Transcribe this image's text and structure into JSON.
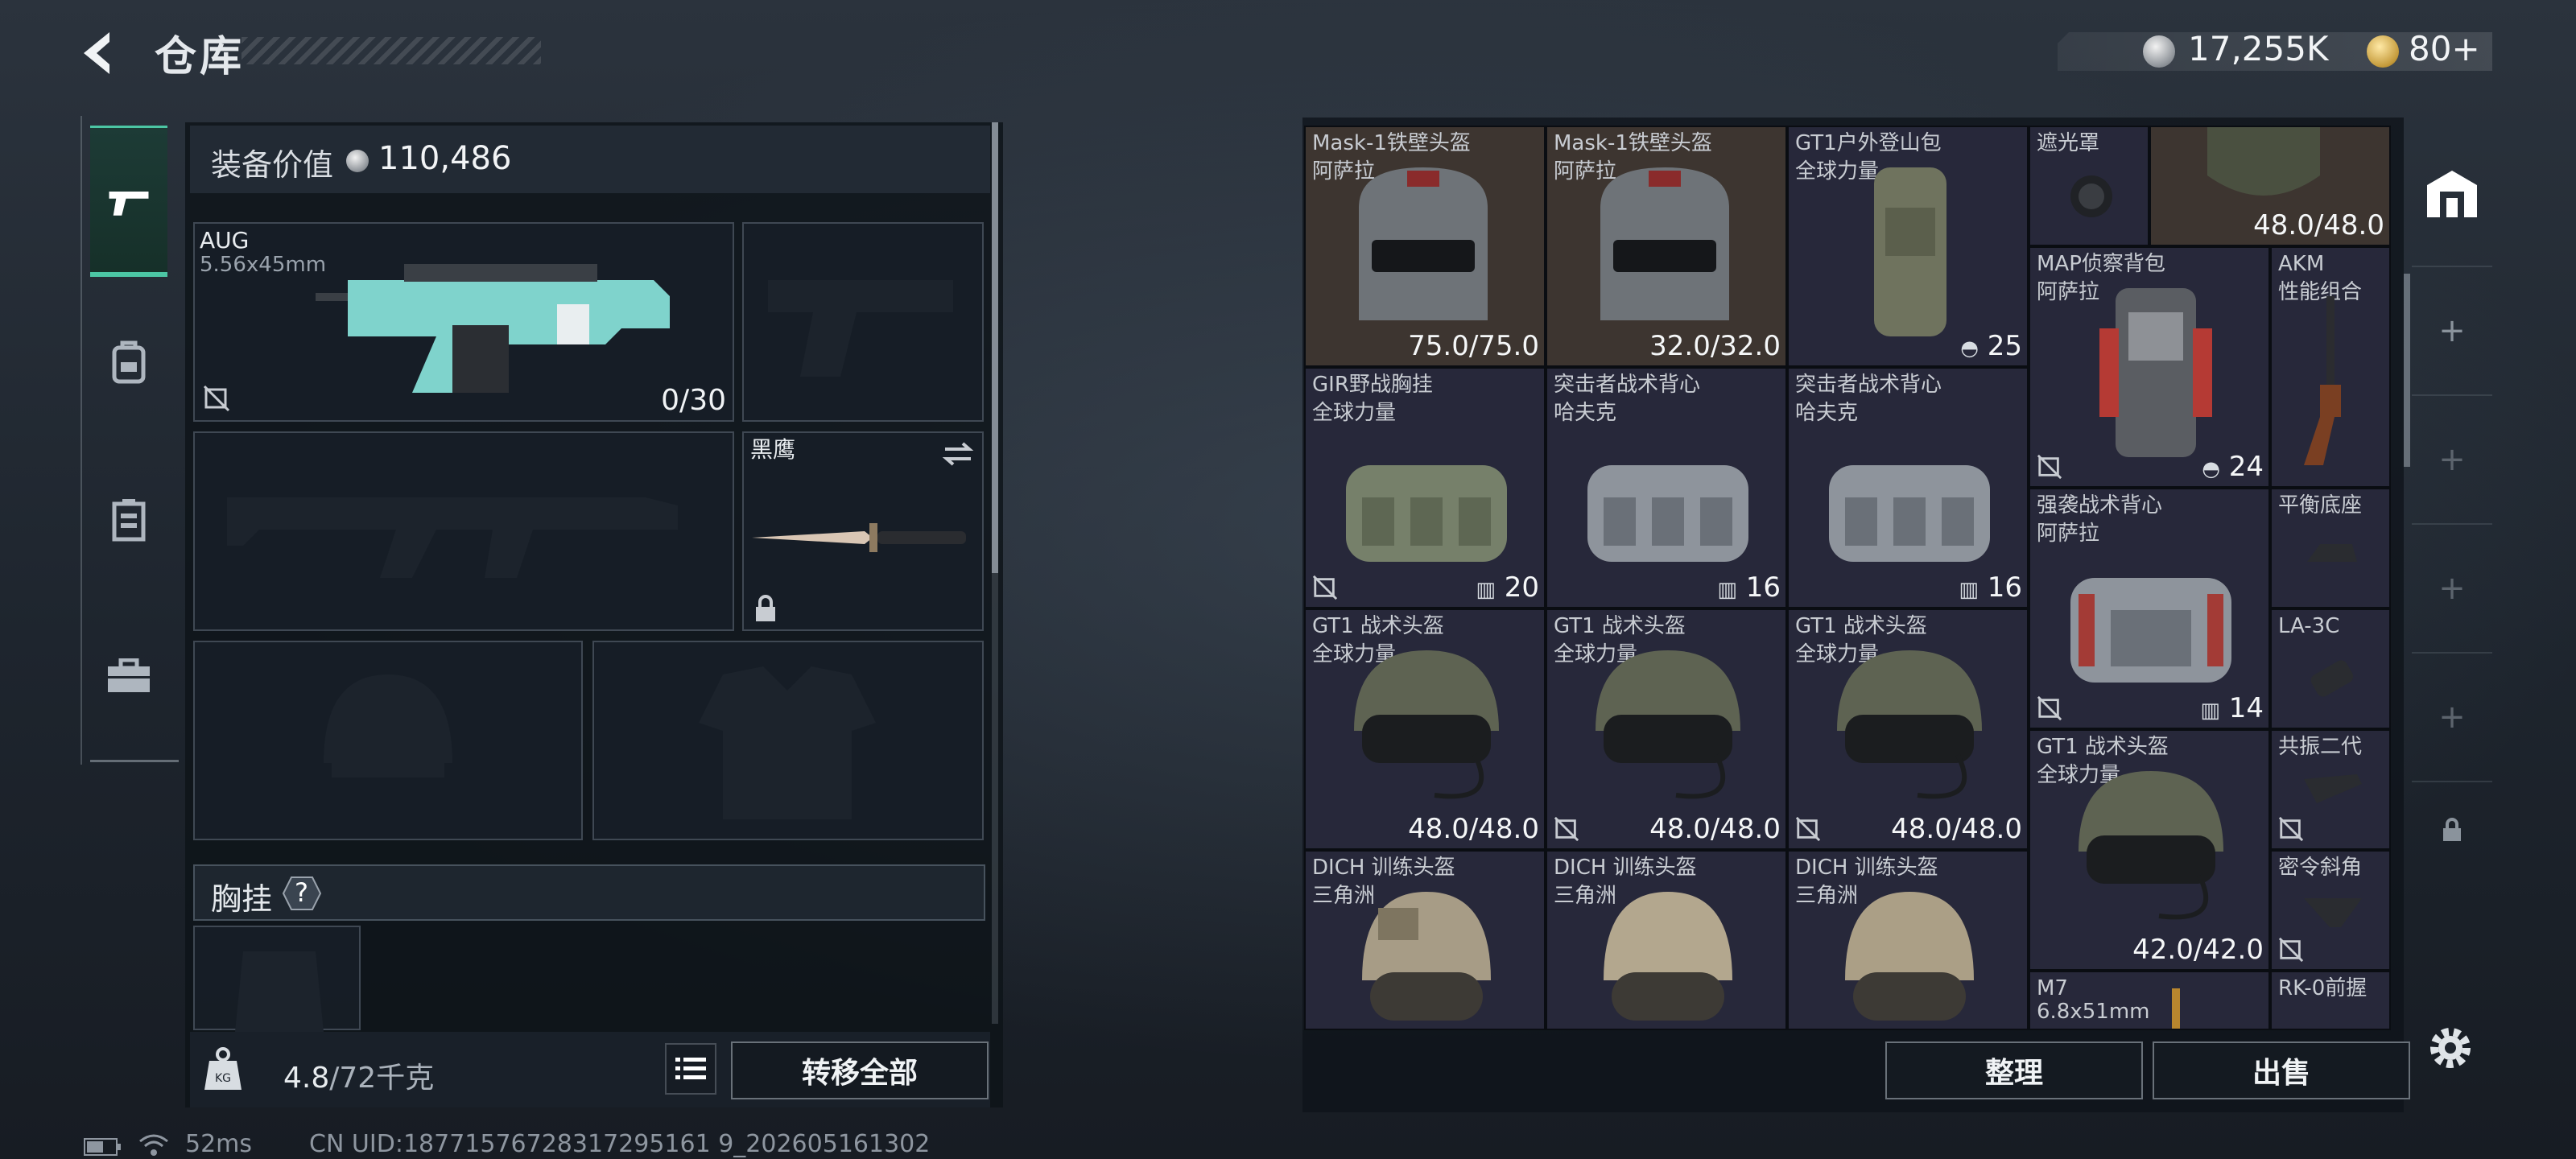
{
  "header": {
    "title": "仓库",
    "currency_silver": "17,255K",
    "currency_gold": "80+"
  },
  "nav": {
    "items": [
      {
        "name": "weapon",
        "active": true
      },
      {
        "name": "backpack",
        "active": false
      },
      {
        "name": "rig",
        "active": false
      },
      {
        "name": "case",
        "active": false
      }
    ]
  },
  "equipment": {
    "value_label": "装备价值",
    "value": "110,486",
    "primary": {
      "name": "AUG",
      "ammo": "5.56x45mm",
      "count": "0/30"
    },
    "melee": {
      "name": "黑鹰"
    },
    "chest_label": "胸挂",
    "help": "?",
    "weight": "4.8",
    "weight_max": "/72千克",
    "transfer_all": "转移全部"
  },
  "inventory": {
    "items": [
      {
        "name": "Mask-1铁壁头盔",
        "sub": "阿萨拉",
        "value": "75.0/75.0"
      },
      {
        "name": "Mask-1铁壁头盔",
        "sub": "阿萨拉",
        "value": "32.0/32.0"
      },
      {
        "name": "GT1户外登山包",
        "sub": "全球力量",
        "value": "25"
      },
      {
        "name": "遮光罩",
        "sub": "",
        "value": ""
      },
      {
        "name": "",
        "sub": "",
        "value": "48.0/48.0"
      },
      {
        "name": "GIR野战胸挂",
        "sub": "全球力量",
        "value": "20"
      },
      {
        "name": "突击者战术背心",
        "sub": "哈夫克",
        "value": "16"
      },
      {
        "name": "突击者战术背心",
        "sub": "哈夫克",
        "value": "16"
      },
      {
        "name": "MAP侦察背包",
        "sub": "阿萨拉",
        "value": "24"
      },
      {
        "name": "AKM",
        "sub": "性能组合",
        "value": ""
      },
      {
        "name": "GT1 战术头盔",
        "sub": "全球力量",
        "value": "48.0/48.0"
      },
      {
        "name": "GT1 战术头盔",
        "sub": "全球力量",
        "value": "48.0/48.0"
      },
      {
        "name": "GT1 战术头盔",
        "sub": "全球力量",
        "value": "48.0/48.0"
      },
      {
        "name": "强袭战术背心",
        "sub": "阿萨拉",
        "value": "14"
      },
      {
        "name": "平衡底座",
        "sub": "",
        "value": ""
      },
      {
        "name": "LA-3C",
        "sub": "",
        "value": ""
      },
      {
        "name": "GT1 战术头盔",
        "sub": "全球力量",
        "value": "42.0/42.0"
      },
      {
        "name": "共振二代",
        "sub": "",
        "value": ""
      },
      {
        "name": "密令斜角",
        "sub": "",
        "value": ""
      },
      {
        "name": "DICH 训练头盔",
        "sub": "三角洲",
        "value": ""
      },
      {
        "name": "DICH 训练头盔",
        "sub": "三角洲",
        "value": ""
      },
      {
        "name": "DICH 训练头盔",
        "sub": "三角洲",
        "value": ""
      },
      {
        "name": "M7",
        "sub": "6.8x51mm",
        "value": ""
      },
      {
        "name": "RK-0前握",
        "sub": "",
        "value": ""
      }
    ],
    "sort_button": "整理",
    "sell_button": "出售"
  },
  "footer": {
    "ping": "52ms",
    "uid": "CN UID:18771576728317295161 9_202605161302"
  },
  "colors": {
    "accent": "#4cc6a4",
    "cell_bg": "#27283a",
    "highlight_cell": "#3d3530",
    "aug_teal": "#7fd3cc"
  }
}
